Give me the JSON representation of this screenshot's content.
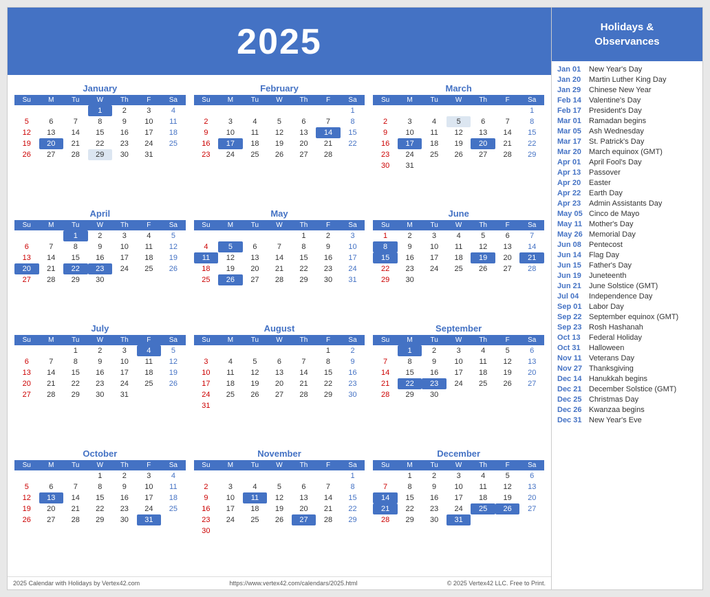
{
  "year": "2025",
  "footer": {
    "left": "2025 Calendar with Holidays by Vertex42.com",
    "center": "https://www.vertex42.com/calendars/2025.html",
    "right": "© 2025 Vertex42 LLC. Free to Print."
  },
  "sidebar": {
    "title": "Holidays &\nObservances",
    "items": [
      {
        "date": "Jan 01",
        "event": "New Year's Day"
      },
      {
        "date": "Jan 20",
        "event": "Martin Luther King Day"
      },
      {
        "date": "Jan 29",
        "event": "Chinese New Year"
      },
      {
        "date": "Feb 14",
        "event": "Valentine's Day"
      },
      {
        "date": "Feb 17",
        "event": "President's Day"
      },
      {
        "date": "Mar 01",
        "event": "Ramadan begins"
      },
      {
        "date": "Mar 05",
        "event": "Ash Wednesday"
      },
      {
        "date": "Mar 17",
        "event": "St. Patrick's Day"
      },
      {
        "date": "Mar 20",
        "event": "March equinox (GMT)"
      },
      {
        "date": "Apr 01",
        "event": "April Fool's Day"
      },
      {
        "date": "Apr 13",
        "event": "Passover"
      },
      {
        "date": "Apr 20",
        "event": "Easter"
      },
      {
        "date": "Apr 22",
        "event": "Earth Day"
      },
      {
        "date": "Apr 23",
        "event": "Admin Assistants Day"
      },
      {
        "date": "May 05",
        "event": "Cinco de Mayo"
      },
      {
        "date": "May 11",
        "event": "Mother's Day"
      },
      {
        "date": "May 26",
        "event": "Memorial Day"
      },
      {
        "date": "Jun 08",
        "event": "Pentecost"
      },
      {
        "date": "Jun 14",
        "event": "Flag Day"
      },
      {
        "date": "Jun 15",
        "event": "Father's Day"
      },
      {
        "date": "Jun 19",
        "event": "Juneteenth"
      },
      {
        "date": "Jun 21",
        "event": "June Solstice (GMT)"
      },
      {
        "date": "Jul 04",
        "event": "Independence Day"
      },
      {
        "date": "Sep 01",
        "event": "Labor Day"
      },
      {
        "date": "Sep 22",
        "event": "September equinox (GMT)"
      },
      {
        "date": "Sep 23",
        "event": "Rosh Hashanah"
      },
      {
        "date": "Oct 13",
        "event": "Federal Holiday"
      },
      {
        "date": "Oct 31",
        "event": "Halloween"
      },
      {
        "date": "Nov 11",
        "event": "Veterans Day"
      },
      {
        "date": "Nov 27",
        "event": "Thanksgiving"
      },
      {
        "date": "Dec 14",
        "event": "Hanukkah begins"
      },
      {
        "date": "Dec 21",
        "event": "December Solstice (GMT)"
      },
      {
        "date": "Dec 25",
        "event": "Christmas Day"
      },
      {
        "date": "Dec 26",
        "event": "Kwanzaa begins"
      },
      {
        "date": "Dec 31",
        "event": "New Year's Eve"
      }
    ]
  },
  "months": [
    {
      "name": "January",
      "weeks": [
        [
          null,
          null,
          null,
          "1h",
          "2",
          "3",
          "4s"
        ],
        [
          "5",
          "6",
          "7",
          "8",
          "9",
          "10",
          "11s"
        ],
        [
          "12",
          "13",
          "14",
          "15",
          "16",
          "17",
          "18s"
        ],
        [
          "19",
          "20h",
          "21",
          "22",
          "23",
          "24",
          "25s"
        ],
        [
          "26",
          "27",
          "28",
          "29l",
          "30",
          "31",
          null
        ]
      ]
    },
    {
      "name": "February",
      "weeks": [
        [
          null,
          null,
          null,
          null,
          null,
          null,
          "1s"
        ],
        [
          "2",
          "3",
          "4",
          "5",
          "6",
          "7",
          "8s"
        ],
        [
          "9",
          "10",
          "11",
          "12",
          "13",
          "14h",
          "15s"
        ],
        [
          "16",
          "17h",
          "18",
          "19",
          "20",
          "21",
          "22s"
        ],
        [
          "23",
          "24",
          "25",
          "26",
          "27",
          "28",
          null
        ]
      ]
    },
    {
      "name": "March",
      "weeks": [
        [
          null,
          null,
          null,
          null,
          null,
          null,
          "1s"
        ],
        [
          "2",
          "3",
          "4",
          "5l",
          "6",
          "7",
          "8s"
        ],
        [
          "9",
          "10",
          "11",
          "12",
          "13",
          "14",
          "15s"
        ],
        [
          "16",
          "17h",
          "18",
          "19",
          "20h",
          "21",
          "22s"
        ],
        [
          "23",
          "24",
          "25",
          "26",
          "27",
          "28",
          "29s"
        ],
        [
          "30",
          "31",
          null,
          null,
          null,
          null,
          null
        ]
      ]
    },
    {
      "name": "April",
      "weeks": [
        [
          null,
          null,
          "1h",
          "2",
          "3",
          "4",
          "5s"
        ],
        [
          "6",
          "7",
          "8",
          "9",
          "10",
          "11",
          "12s"
        ],
        [
          "13",
          "14",
          "15",
          "16",
          "17",
          "18",
          "19s"
        ],
        [
          "20h",
          "21",
          "22h",
          "23h",
          "24",
          "25",
          "26s"
        ],
        [
          "27",
          "28",
          "29",
          "30",
          null,
          null,
          null
        ]
      ]
    },
    {
      "name": "May",
      "weeks": [
        [
          null,
          null,
          null,
          null,
          "1",
          "2",
          "3s"
        ],
        [
          "4",
          "5h",
          "6",
          "7",
          "8",
          "9",
          "10s"
        ],
        [
          "11h",
          "12",
          "13",
          "14",
          "15",
          "16",
          "17s"
        ],
        [
          "18",
          "19",
          "20",
          "21",
          "22",
          "23",
          "24s"
        ],
        [
          "25",
          "26h",
          "27",
          "28",
          "29",
          "30",
          "31s"
        ]
      ]
    },
    {
      "name": "June",
      "weeks": [
        [
          "1",
          "2",
          "3",
          "4",
          "5",
          "6",
          "7s"
        ],
        [
          "8h",
          "9",
          "10",
          "11",
          "12",
          "13",
          "14s"
        ],
        [
          "15h",
          "16",
          "17",
          "18",
          "19h",
          "20",
          "21hs"
        ],
        [
          "22",
          "23",
          "24",
          "25",
          "26",
          "27",
          "28s"
        ],
        [
          "29",
          "30",
          null,
          null,
          null,
          null,
          null
        ]
      ]
    },
    {
      "name": "July",
      "weeks": [
        [
          null,
          null,
          "1",
          "2",
          "3",
          "4h",
          "5s"
        ],
        [
          "6",
          "7",
          "8",
          "9",
          "10",
          "11",
          "12s"
        ],
        [
          "13",
          "14",
          "15",
          "16",
          "17",
          "18",
          "19s"
        ],
        [
          "20",
          "21",
          "22",
          "23",
          "24",
          "25",
          "26s"
        ],
        [
          "27",
          "28",
          "29",
          "30",
          "31",
          null,
          null
        ]
      ]
    },
    {
      "name": "August",
      "weeks": [
        [
          null,
          null,
          null,
          null,
          null,
          "1",
          "2s"
        ],
        [
          "3",
          "4",
          "5",
          "6",
          "7",
          "8",
          "9s"
        ],
        [
          "10",
          "11",
          "12",
          "13",
          "14",
          "15",
          "16s"
        ],
        [
          "17",
          "18",
          "19",
          "20",
          "21",
          "22",
          "23s"
        ],
        [
          "24",
          "25",
          "26",
          "27",
          "28",
          "29",
          "30s"
        ],
        [
          "31",
          null,
          null,
          null,
          null,
          null,
          null
        ]
      ]
    },
    {
      "name": "September",
      "weeks": [
        [
          null,
          "1h",
          "2",
          "3",
          "4",
          "5",
          "6s"
        ],
        [
          "7",
          "8",
          "9",
          "10",
          "11",
          "12",
          "13s"
        ],
        [
          "14",
          "15",
          "16",
          "17",
          "18",
          "19",
          "20s"
        ],
        [
          "21",
          "22h",
          "23h",
          "24",
          "25",
          "26",
          "27s"
        ],
        [
          "28",
          "29",
          "30",
          null,
          null,
          null,
          null
        ]
      ]
    },
    {
      "name": "October",
      "weeks": [
        [
          null,
          null,
          null,
          "1",
          "2",
          "3",
          "4s"
        ],
        [
          "5",
          "6",
          "7",
          "8",
          "9",
          "10",
          "11s"
        ],
        [
          "12",
          "13h",
          "14",
          "15",
          "16",
          "17",
          "18s"
        ],
        [
          "19",
          "20",
          "21",
          "22",
          "23",
          "24",
          "25s"
        ],
        [
          "26",
          "27",
          "28",
          "29",
          "30",
          "31h",
          null
        ]
      ]
    },
    {
      "name": "November",
      "weeks": [
        [
          null,
          null,
          null,
          null,
          null,
          null,
          "1s"
        ],
        [
          "2",
          "3",
          "4",
          "5",
          "6",
          "7",
          "8s"
        ],
        [
          "9",
          "10",
          "11h",
          "12",
          "13",
          "14",
          "15s"
        ],
        [
          "16",
          "17",
          "18",
          "19",
          "20",
          "21",
          "22s"
        ],
        [
          "23",
          "24",
          "25",
          "26",
          "27h",
          "28",
          "29s"
        ],
        [
          "30",
          null,
          null,
          null,
          null,
          null,
          null
        ]
      ]
    },
    {
      "name": "December",
      "weeks": [
        [
          null,
          "1",
          "2",
          "3",
          "4",
          "5",
          "6s"
        ],
        [
          "7",
          "8",
          "9",
          "10",
          "11",
          "12",
          "13s"
        ],
        [
          "14h",
          "15",
          "16",
          "17",
          "18",
          "19",
          "20s"
        ],
        [
          "21h",
          "22",
          "23",
          "24",
          "25h",
          "26h",
          "27s"
        ],
        [
          "28",
          "29",
          "30",
          "31h",
          null,
          null,
          null
        ]
      ]
    }
  ]
}
